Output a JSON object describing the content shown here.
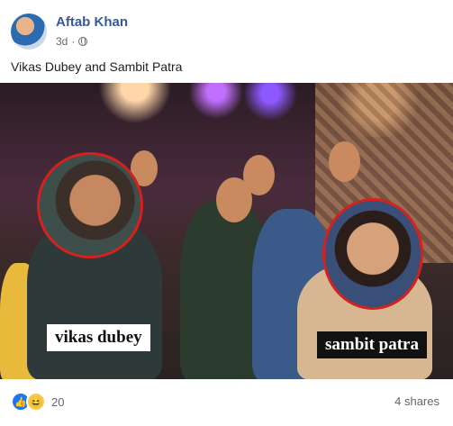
{
  "post": {
    "author": "Aftab Khan",
    "time": "3d",
    "privacy_icon": "globe-icon",
    "caption": "Vikas Dubey and Sambit Patra",
    "image": {
      "label_left": "vikas dubey",
      "label_right": "sambit patra",
      "circle_color": "#d5211e"
    },
    "reactions": {
      "icons": [
        "like-icon",
        "haha-icon"
      ],
      "count": "20"
    },
    "shares": "4 shares"
  }
}
